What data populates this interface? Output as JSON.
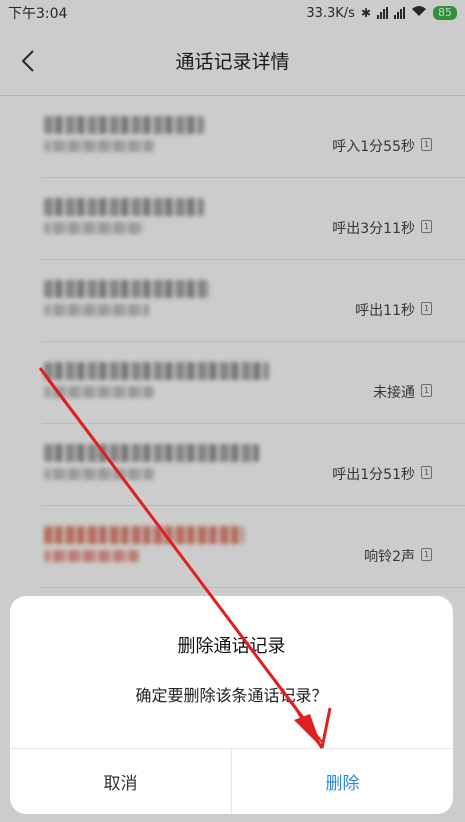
{
  "status_bar": {
    "time": "下午3:04",
    "speed": "33.3K/s",
    "bluetooth_icon": "bluetooth-icon",
    "battery": "85"
  },
  "header": {
    "title": "通话记录详情",
    "back_icon": "chevron-left-icon"
  },
  "records": [
    {
      "label": "呼入1分55秒",
      "sim": "1"
    },
    {
      "label": "呼出3分11秒",
      "sim": "1"
    },
    {
      "label": "呼出11秒",
      "sim": "1"
    },
    {
      "label": "未接通",
      "sim": "1"
    },
    {
      "label": "呼出1分51秒",
      "sim": "1"
    },
    {
      "label": "响铃2声",
      "sim": "1"
    }
  ],
  "dialog": {
    "title": "删除通话记录",
    "message": "确定要删除该条通话记录？",
    "cancel_label": "取消",
    "confirm_label": "删除"
  },
  "colors": {
    "accent": "#2d8ad8",
    "annotation_arrow": "#e02020",
    "battery": "#3cb54b"
  }
}
